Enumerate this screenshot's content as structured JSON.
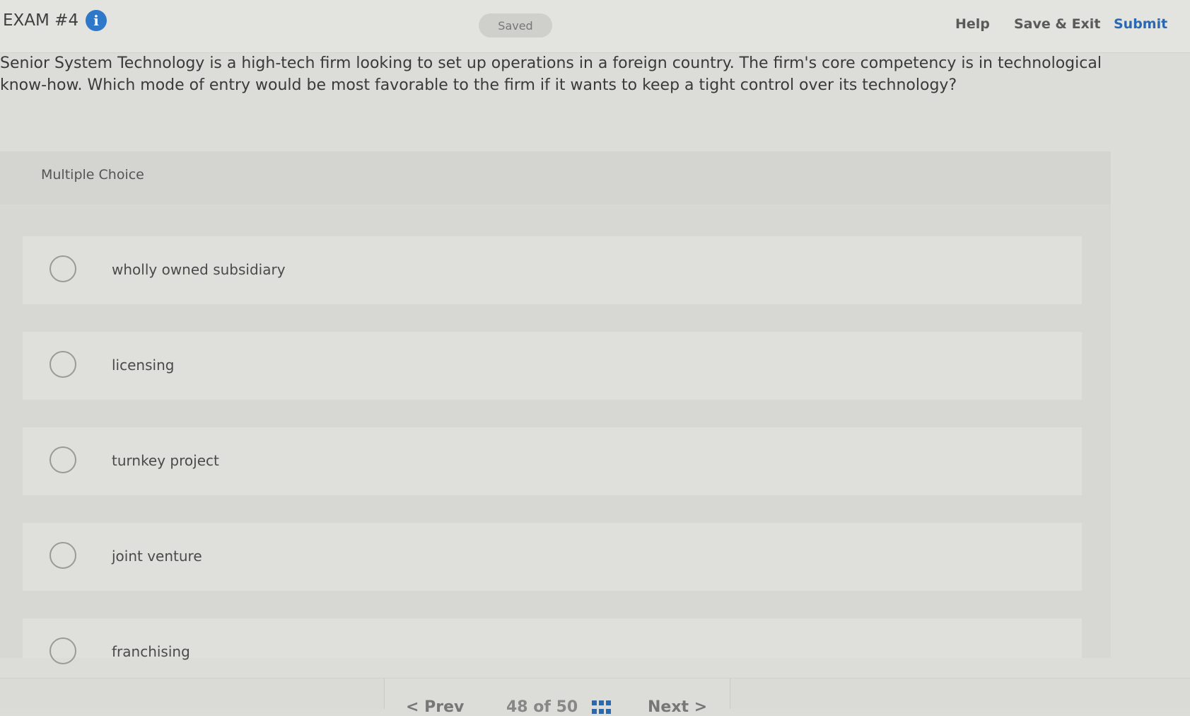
{
  "header": {
    "exam_title": "EXAM #4",
    "info_icon": "i",
    "saved_label": "Saved",
    "help_label": "Help",
    "save_exit_label": "Save & Exit",
    "submit_label": "Submit",
    "submit_color": "#2b68b0",
    "info_icon_color": "#2d78c9"
  },
  "question": {
    "text": "Senior System Technology is a high-tech firm looking to set up operations in a foreign country. The firm's core competency is in technological know-how. Which mode of entry would be most favorable to the firm if it wants to keep a tight control over its technology?"
  },
  "multiple_choice": {
    "label": "Multiple Choice",
    "options": [
      {
        "label": "wholly owned subsidiary"
      },
      {
        "label": "licensing"
      },
      {
        "label": "turnkey project"
      },
      {
        "label": "joint venture"
      },
      {
        "label": "franchising"
      }
    ]
  },
  "footer": {
    "prev_label": "< Prev",
    "counter_text": "48 of 50",
    "next_label": "Next >",
    "grid_icon": "grid-icon"
  }
}
